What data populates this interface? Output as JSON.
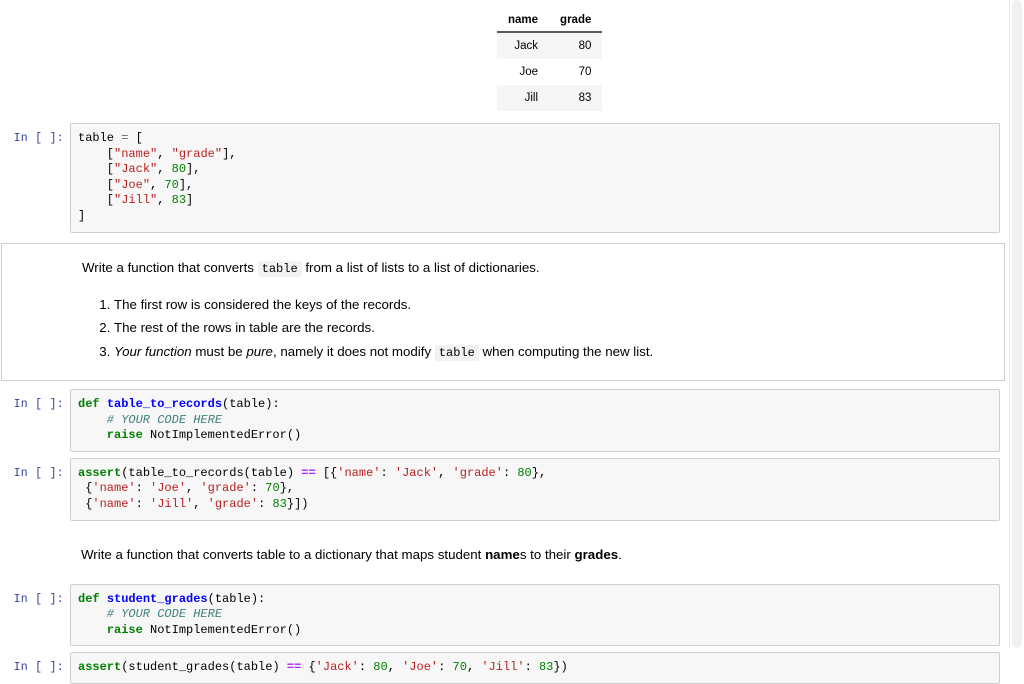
{
  "output_table": {
    "headers": [
      "name",
      "grade"
    ],
    "rows": [
      {
        "name": "Jack",
        "grade": "80"
      },
      {
        "name": "Joe",
        "grade": "70"
      },
      {
        "name": "Jill",
        "grade": "83"
      }
    ]
  },
  "prompt_label": "In [ ]:",
  "cells": {
    "code_table_def": {
      "l1_a": "table ",
      "l1_op": "=",
      "l1_b": " [",
      "l2_pre": "    [",
      "l2_s1": "\"name\"",
      "l2_mid": ", ",
      "l2_s2": "\"grade\"",
      "l2_post": "],",
      "l3_pre": "    [",
      "l3_s1": "\"Jack\"",
      "l3_mid": ", ",
      "l3_num": "80",
      "l3_post": "],",
      "l4_pre": "    [",
      "l4_s1": "\"Joe\"",
      "l4_mid": ", ",
      "l4_num": "70",
      "l4_post": "],",
      "l5_pre": "    [",
      "l5_s1": "\"Jill\"",
      "l5_mid": ", ",
      "l5_num": "83",
      "l5_post": "]",
      "l6": "]"
    },
    "markdown_1": {
      "p1_a": "Write a function that converts ",
      "p1_code": "table",
      "p1_b": " from a list of lists to a list of dictionaries.",
      "li1": "The first row is considered the keys of the records.",
      "li2": "The rest of the rows in table are the records.",
      "li3_em1": "Your function",
      "li3_a": " must be ",
      "li3_em2": "pure",
      "li3_b": ", namely it does not modify ",
      "li3_code": "table",
      "li3_c": " when computing the new list."
    },
    "code_table_to_records": {
      "kw_def": "def",
      "fname": "table_to_records",
      "sig": "(table):",
      "comment": "    # YOUR CODE HERE",
      "kw_raise": "    raise",
      "exc": " NotImplementedError()"
    },
    "code_assert_records": {
      "kw_assert": "assert",
      "a1": "(table_to_records(table) ",
      "op": "==",
      "a2": " [{",
      "s_name1": "'name'",
      "a3": ": ",
      "s_jack": "'Jack'",
      "a4": ", ",
      "s_grade1": "'grade'",
      "a5": ": ",
      "n80": "80",
      "a6": "},",
      "l2_pre": " {",
      "l2_s1": "'name'",
      "l2_m1": ": ",
      "l2_s2": "'Joe'",
      "l2_m2": ", ",
      "l2_s3": "'grade'",
      "l2_m3": ": ",
      "l2_n": "70",
      "l2_post": "},",
      "l3_pre": " {",
      "l3_s1": "'name'",
      "l3_m1": ": ",
      "l3_s2": "'Jill'",
      "l3_m2": ", ",
      "l3_s3": "'grade'",
      "l3_m3": ": ",
      "l3_n": "83",
      "l3_post": "}])"
    },
    "markdown_2": {
      "a": "Write a function that converts table to a dictionary that maps student ",
      "b_bold": "name",
      "c": "s to their ",
      "d_bold": "grades",
      "e": "."
    },
    "code_student_grades": {
      "kw_def": "def",
      "fname": "student_grades",
      "sig": "(table):",
      "comment": "    # YOUR CODE HERE",
      "kw_raise": "    raise",
      "exc": " NotImplementedError()"
    },
    "code_assert_grades": {
      "kw_assert": "assert",
      "a1": "(student_grades(table) ",
      "op": "==",
      "a2": " {",
      "s_jack": "'Jack'",
      "a3": ": ",
      "n80": "80",
      "a4": ", ",
      "s_joe": "'Joe'",
      "a5": ": ",
      "n70": "70",
      "a6": ", ",
      "s_jill": "'Jill'",
      "a7": ": ",
      "n83": "83",
      "a8": "})"
    }
  },
  "colors": {
    "prompt": "#303F9F",
    "string": "#BA2121",
    "number": "#008000",
    "keyword": "#008000",
    "function": "#0000FF",
    "comment": "#408080",
    "operator": "#AA22FF",
    "cell_bg": "#F7F7F7",
    "cell_border": "#CFCFCF"
  }
}
